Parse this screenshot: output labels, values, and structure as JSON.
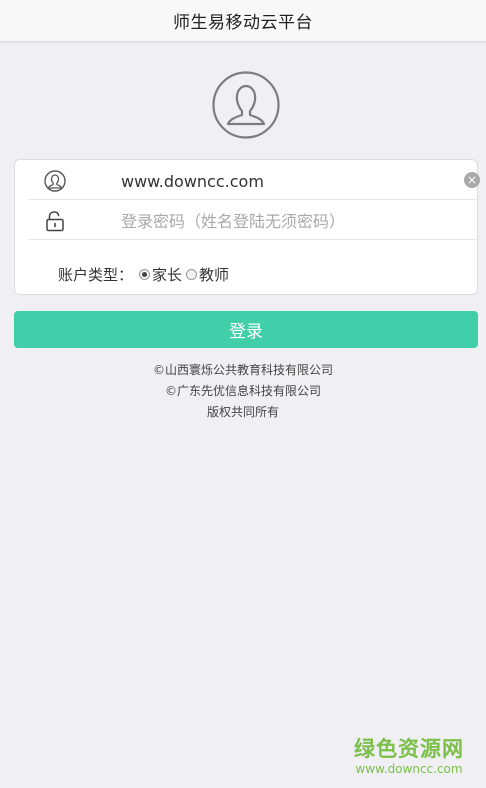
{
  "header": {
    "title": "师生易移动云平台"
  },
  "form": {
    "username_value": "www.downcc.com",
    "password_placeholder": "登录密码（姓名登陆无须密码）",
    "clear_symbol": "×",
    "account_type_label": "账户类型：",
    "account_types": [
      {
        "label": "家长",
        "selected": true
      },
      {
        "label": "教师",
        "selected": false
      }
    ]
  },
  "login_button": {
    "label": "登录"
  },
  "footer": {
    "line1": "©山西寰烁公共教育科技有限公司",
    "line2": "©广东先优信息科技有限公司",
    "line3": "版权共同所有"
  },
  "watermark": {
    "title": "绿色资源网",
    "url": "www.downcc.com"
  },
  "colors": {
    "accent": "#41cfa9",
    "background": "#efeff4",
    "watermark": "#7cc04a"
  },
  "icons": {
    "avatar": "user-avatar-icon",
    "user": "user-icon",
    "lock": "lock-icon",
    "clear": "clear-icon"
  }
}
